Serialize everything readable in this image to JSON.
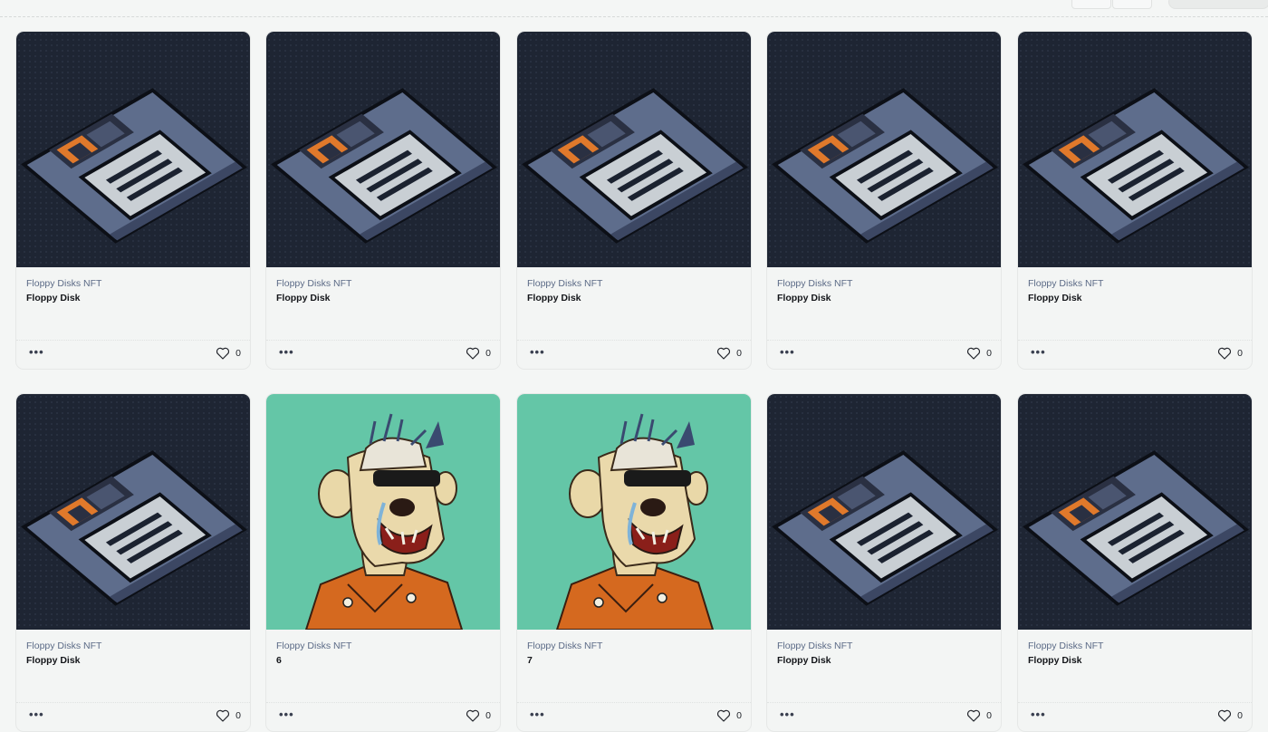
{
  "cards": [
    {
      "collection": "Floppy Disks NFT",
      "title": "Floppy Disk",
      "likes": "0",
      "art": "floppy-disk"
    },
    {
      "collection": "Floppy Disks NFT",
      "title": "Floppy Disk",
      "likes": "0",
      "art": "floppy-disk"
    },
    {
      "collection": "Floppy Disks NFT",
      "title": "Floppy Disk",
      "likes": "0",
      "art": "floppy-disk"
    },
    {
      "collection": "Floppy Disks NFT",
      "title": "Floppy Disk",
      "likes": "0",
      "art": "floppy-disk"
    },
    {
      "collection": "Floppy Disks NFT",
      "title": "Floppy Disk",
      "likes": "0",
      "art": "floppy-disk"
    },
    {
      "collection": "Floppy Disks NFT",
      "title": "Floppy Disk",
      "likes": "0",
      "art": "floppy-disk"
    },
    {
      "collection": "Floppy Disks NFT",
      "title": "6",
      "likes": "0",
      "art": "ape-portrait"
    },
    {
      "collection": "Floppy Disks NFT",
      "title": "7",
      "likes": "0",
      "art": "ape-portrait"
    },
    {
      "collection": "Floppy Disks NFT",
      "title": "Floppy Disk",
      "likes": "0",
      "art": "floppy-disk"
    },
    {
      "collection": "Floppy Disks NFT",
      "title": "Floppy Disk",
      "likes": "0",
      "art": "floppy-disk"
    }
  ],
  "icons": {
    "more": "more-dots-icon",
    "like": "heart-icon"
  },
  "colors": {
    "dark_bg": "#1e2533",
    "teal_bg": "#64c6a7",
    "accent_orange": "#e0792b"
  }
}
